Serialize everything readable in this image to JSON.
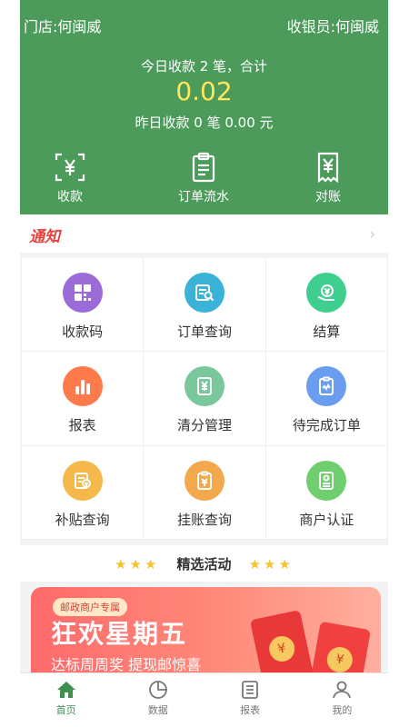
{
  "header": {
    "store_label": "门店:何闽威",
    "cashier_label": "收银员:何闽威",
    "today_text": "今日收款 2 笔，合计",
    "today_amount": "0.02",
    "yesterday_text": "昨日收款 0 笔 0.00 元",
    "buttons": [
      {
        "label": "收款",
        "icon": "scan-yuan-icon"
      },
      {
        "label": "订单流水",
        "icon": "clipboard-icon"
      },
      {
        "label": "对账",
        "icon": "receipt-icon"
      }
    ]
  },
  "notice": {
    "tag": "通知"
  },
  "grid": [
    {
      "label": "收款码",
      "icon": "qr-code-icon",
      "color": "#9b6bd8"
    },
    {
      "label": "订单查询",
      "icon": "order-search-icon",
      "color": "#3bb3d8"
    },
    {
      "label": "结算",
      "icon": "settlement-icon",
      "color": "#3ecf8e"
    },
    {
      "label": "报表",
      "icon": "bar-chart-icon",
      "color": "#ff7a4a"
    },
    {
      "label": "清分管理",
      "icon": "clearing-icon",
      "color": "#79c79a"
    },
    {
      "label": "待完成订单",
      "icon": "pending-order-icon",
      "color": "#6a9cf0"
    },
    {
      "label": "补贴查询",
      "icon": "subsidy-icon",
      "color": "#f5b84a"
    },
    {
      "label": "挂账查询",
      "icon": "credit-icon",
      "color": "#f3a94b"
    },
    {
      "label": "商户认证",
      "icon": "merchant-cert-icon",
      "color": "#6fcf6f"
    }
  ],
  "featured": {
    "title": "精选活动",
    "stars": "★★★"
  },
  "banner": {
    "pill": "邮政商户专属",
    "headline": "狂欢星期五",
    "subline": "达标周周奖 提现邮惊喜"
  },
  "tabbar": [
    {
      "label": "首页",
      "icon": "home-icon",
      "active": true
    },
    {
      "label": "数据",
      "icon": "pie-chart-icon",
      "active": false
    },
    {
      "label": "报表",
      "icon": "report-list-icon",
      "active": false
    },
    {
      "label": "我的",
      "icon": "user-icon",
      "active": false
    }
  ],
  "colors": {
    "primary_green": "#4c9b5b",
    "amount_yellow": "#ffe65a",
    "notice_red": "#e0463c"
  }
}
